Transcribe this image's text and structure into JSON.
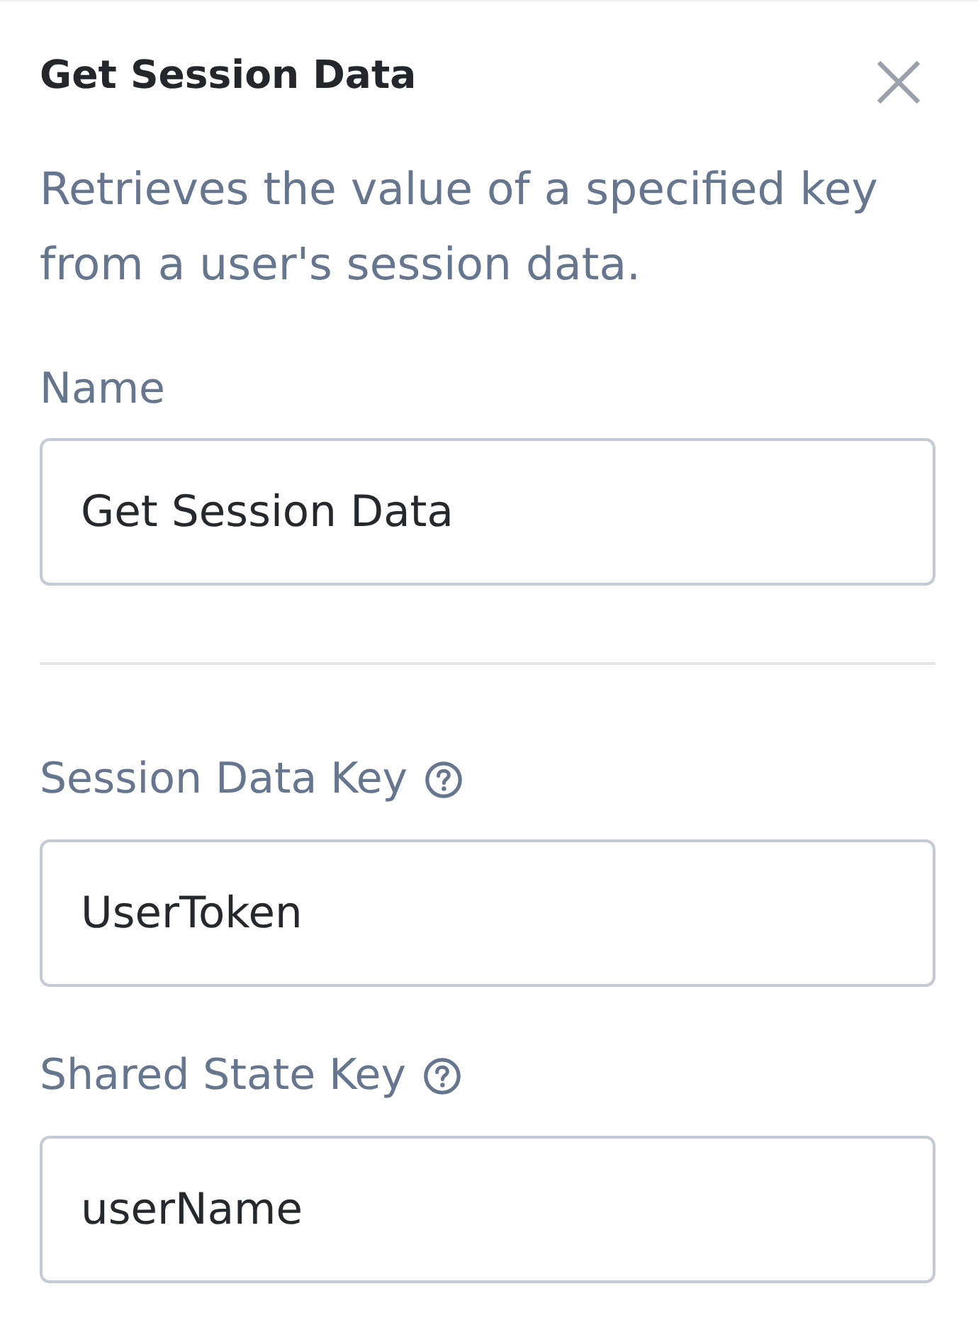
{
  "panel": {
    "title": "Get Session Data",
    "description": "Retrieves the value of a specified key from a user's session data."
  },
  "sections": [
    {
      "fields": [
        {
          "label": "Name",
          "help": false,
          "value": "Get Session Data"
        }
      ]
    },
    {
      "fields": [
        {
          "label": "Session Data Key",
          "help": true,
          "value": "UserToken"
        },
        {
          "label": "Shared State Key",
          "help": true,
          "value": "userName"
        }
      ]
    }
  ]
}
